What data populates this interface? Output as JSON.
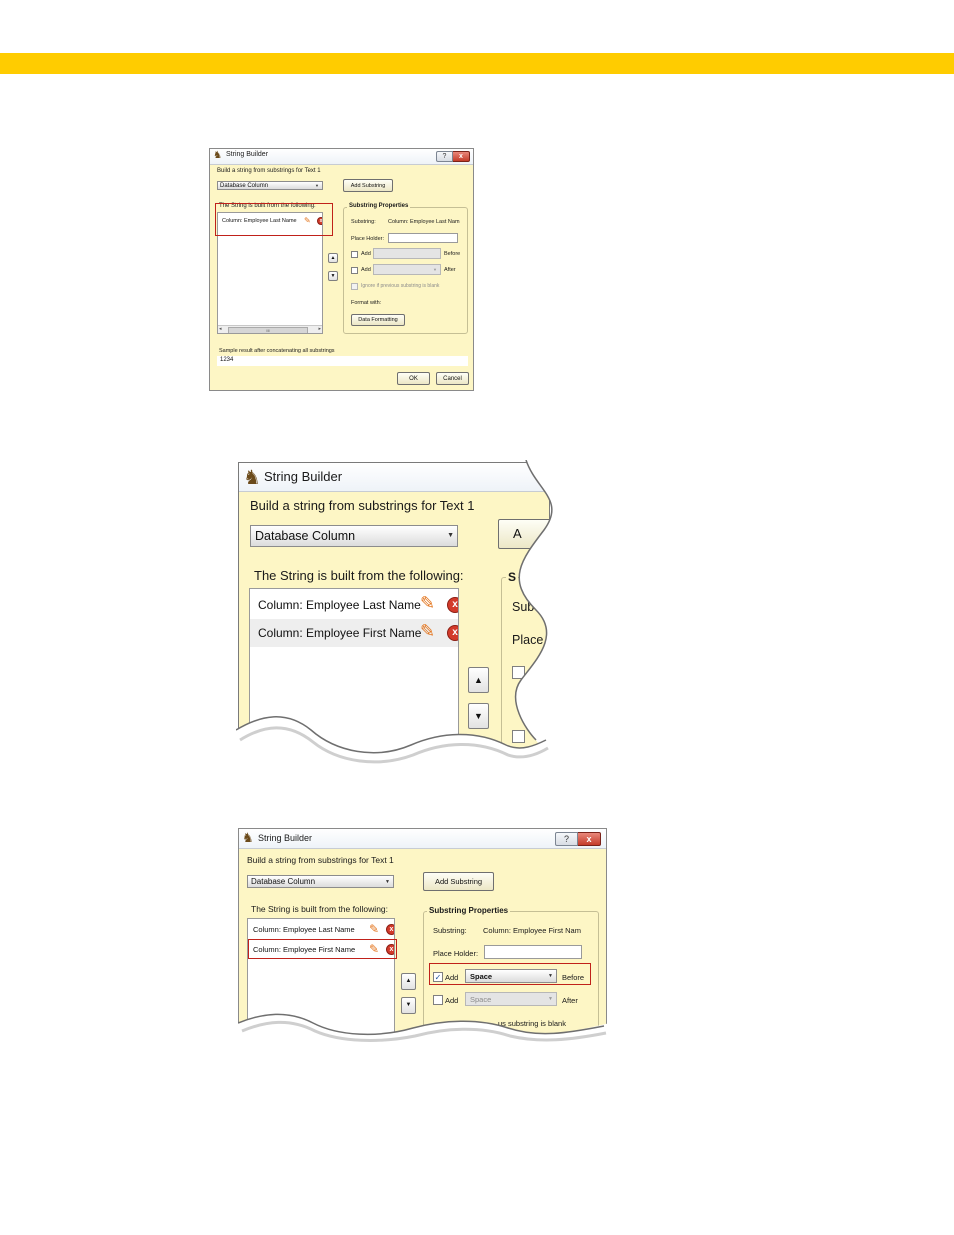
{
  "colors": {
    "banner": "#ffcc00",
    "window_bg": "#fdf6c5",
    "highlight": "#c0211a"
  },
  "window1": {
    "title": "String Builder",
    "help_glyph": "?",
    "close_glyph": "x",
    "prompt": "Build a string from substrings for Text 1",
    "source_combo": "Database Column",
    "add_substring": "Add Substring",
    "list_caption": "The String is built from the following:",
    "items": [
      "Column: Employee Last Name"
    ],
    "scroll_thumb": "III",
    "group_title": "Substring Properties",
    "substring_label": "Substring:",
    "substring_value": "Column: Employee Last Nam",
    "placeholder_label": "Place Holder:",
    "add1_label": "Add",
    "before_label": "Before",
    "add2_label": "Add",
    "after_label": "After",
    "ignore_label": "Ignore if previous substring is blank",
    "format_label": "Format with:",
    "data_formatting": "Data Formatting",
    "sample_label": "Sample result after concatenating all substrings",
    "sample_value": "1234",
    "ok": "OK",
    "cancel": "Cancel"
  },
  "window2": {
    "title": "String Builder",
    "prompt": "Build a string from substrings for Text 1",
    "source_combo": "Database Column",
    "add_button_partial": "A",
    "list_caption": "The String is built from the following:",
    "items": [
      "Column: Employee Last Name",
      "Column: Employee First Name"
    ],
    "group_partial": "S",
    "substring_partial": "Sub",
    "placeholder_partial": "Place"
  },
  "window3": {
    "title": "String Builder",
    "help_glyph": "?",
    "close_glyph": "x",
    "prompt": "Build a string from substrings for Text 1",
    "source_combo": "Database Column",
    "add_substring": "Add Substring",
    "list_caption": "The String is built from the following:",
    "items": [
      "Column: Employee Last Name",
      "Column: Employee First Name"
    ],
    "group_title": "Substring Properties",
    "substring_label": "Substring:",
    "substring_value": "Column: Employee First Nam",
    "placeholder_label": "Place Holder:",
    "add1_label": "Add",
    "add1_value": "Space",
    "before_label": "Before",
    "add2_label": "Add",
    "add2_value": "Space",
    "after_label": "After",
    "ignore_partial": "us substring is blank"
  }
}
